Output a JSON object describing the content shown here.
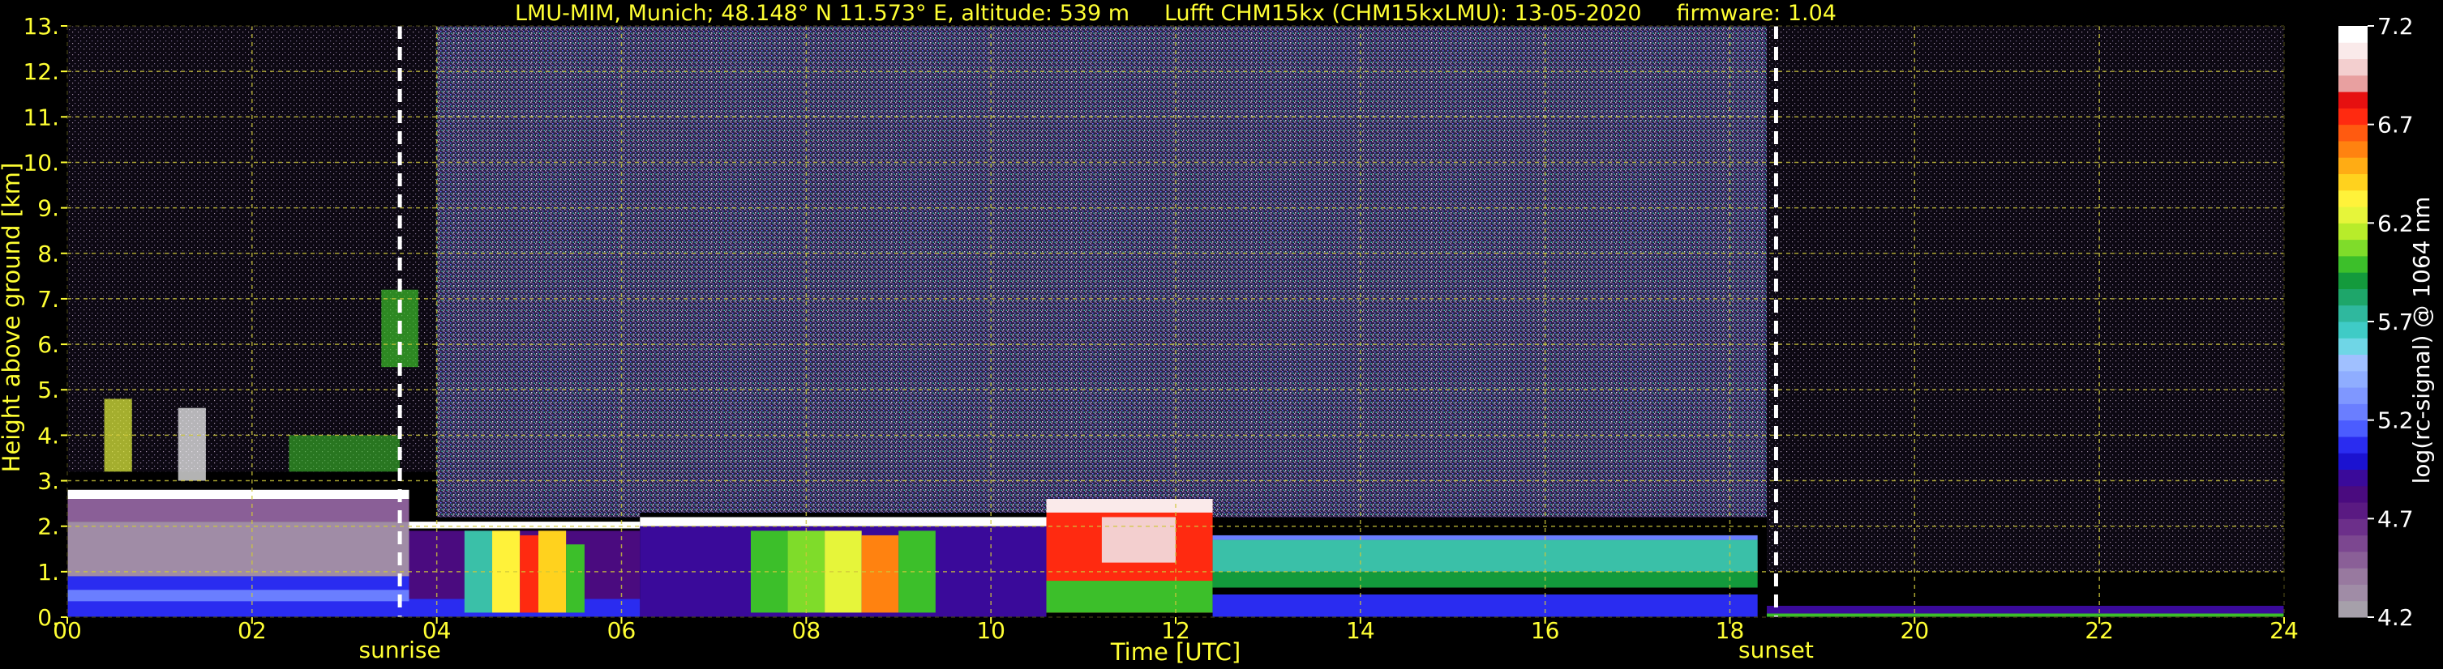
{
  "chart_data": {
    "type": "heatmap",
    "title": "LMU-MIM, Munich; 48.148° N 11.573° E, altitude: 539 m     Lufft CHM15kx (CHM15kxLMU): 13-05-2020     firmware: 1.04",
    "xlabel": "Time [UTC]",
    "ylabel": "Height above ground [km]",
    "xlim": [
      0,
      24
    ],
    "ylim": [
      0,
      13
    ],
    "x_ticks": [
      "00",
      "02",
      "04",
      "06",
      "08",
      "10",
      "12",
      "14",
      "16",
      "18",
      "20",
      "22",
      "24"
    ],
    "y_ticks": [
      "0.",
      "1.",
      "2.",
      "3.",
      "4.",
      "5.",
      "6.",
      "7.",
      "8.",
      "9.",
      "10.",
      "11.",
      "12.",
      "13."
    ],
    "grid": true,
    "markers": [
      {
        "label": "sunrise",
        "x": 3.6
      },
      {
        "label": "sunset",
        "x": 18.5
      }
    ],
    "colorbar": {
      "label": "log(rc-signal) @ 1064 nm",
      "range": [
        4.2,
        7.2
      ],
      "ticks": [
        "4.2",
        "4.7",
        "5.2",
        "5.7",
        "6.2",
        "6.7",
        "7.2"
      ],
      "colors": [
        "#a6a0aa",
        "#a08ca6",
        "#98799f",
        "#8a5f97",
        "#7c4790",
        "#6c2f8a",
        "#5a1a82",
        "#4a0b7f",
        "#3a0a9a",
        "#1b12d0",
        "#2a2cf0",
        "#4b5cff",
        "#6a7eff",
        "#7f97ff",
        "#8fadff",
        "#a0c0ff",
        "#6fd6e6",
        "#3fcbc6",
        "#2fb89e",
        "#1ea66a",
        "#139a3c",
        "#3cbf2a",
        "#7fdc2a",
        "#b8ec2a",
        "#e6f53a",
        "#fff23a",
        "#ffd21e",
        "#ffac14",
        "#ff8210",
        "#ff5a10",
        "#ff2a10",
        "#e61010",
        "#e8a0a0",
        "#f3cfcf",
        "#faeaea",
        "#ffffff"
      ]
    },
    "cloud_layers": [
      {
        "from": 0.0,
        "to": 3.6,
        "base": 2.6,
        "top": 2.8,
        "kind": "aerosol-top"
      },
      {
        "from": 3.6,
        "to": 6.2,
        "base": 2.0,
        "top": 2.2,
        "kind": "aerosol-top"
      },
      {
        "from": 6.2,
        "to": 10.8,
        "base": 2.1,
        "top": 2.3,
        "kind": "aerosol-top"
      },
      {
        "from": 10.6,
        "to": 12.3,
        "base": 0.2,
        "top": 2.6,
        "kind": "cloud"
      },
      {
        "from": 12.3,
        "to": 18.3,
        "base": 0.5,
        "top": 1.7,
        "kind": "boundary-layer"
      }
    ]
  }
}
